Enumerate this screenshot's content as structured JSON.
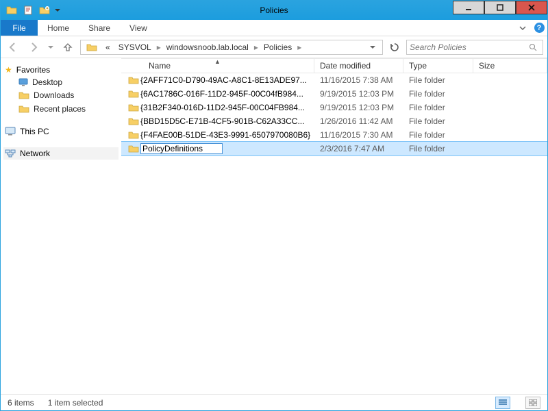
{
  "window": {
    "title": "Policies"
  },
  "ribbon": {
    "file": "File",
    "home": "Home",
    "share": "Share",
    "view": "View"
  },
  "breadcrumb": {
    "ellipsis": "«",
    "seg1": "SYSVOL",
    "seg2": "windowsnoob.lab.local",
    "seg3": "Policies"
  },
  "search": {
    "placeholder": "Search Policies"
  },
  "navpane": {
    "favorites": "Favorites",
    "desktop": "Desktop",
    "downloads": "Downloads",
    "recent": "Recent places",
    "thispc": "This PC",
    "network": "Network"
  },
  "columns": {
    "name": "Name",
    "date": "Date modified",
    "type": "Type",
    "size": "Size"
  },
  "rows": [
    {
      "name": "{2AFF71C0-D790-49AC-A8C1-8E13ADE97...",
      "date": "11/16/2015 7:38 AM",
      "type": "File folder"
    },
    {
      "name": "{6AC1786C-016F-11D2-945F-00C04fB984...",
      "date": "9/19/2015 12:03 PM",
      "type": "File folder"
    },
    {
      "name": "{31B2F340-016D-11D2-945F-00C04FB984...",
      "date": "9/19/2015 12:03 PM",
      "type": "File folder"
    },
    {
      "name": "{BBD15D5C-E71B-4CF5-901B-C62A33CC...",
      "date": "1/26/2016 11:42 AM",
      "type": "File folder"
    },
    {
      "name": "{F4FAE00B-51DE-43E3-9991-6507970080B6}",
      "date": "11/16/2015 7:30 AM",
      "type": "File folder"
    },
    {
      "name": "PolicyDefinitions",
      "date": "2/3/2016 7:47 AM",
      "type": "File folder",
      "selected": true,
      "rename": true
    }
  ],
  "status": {
    "count": "6 items",
    "selection": "1 item selected"
  }
}
